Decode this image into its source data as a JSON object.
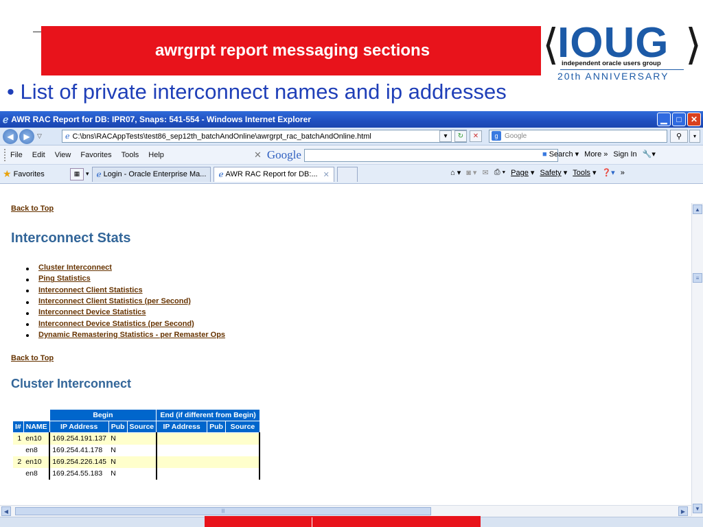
{
  "slide": {
    "banner_title": "awrgrpt report messaging sections",
    "logo": {
      "word": "IOUG",
      "subtitle": "independent oracle users group",
      "anniversary": "20th ANNIVERSARY"
    },
    "bullet": "List of private interconnect names and ip addresses"
  },
  "browser": {
    "window_title": "AWR RAC Report for DB: IPR07, Snaps: 541-554 - Windows Internet Explorer",
    "address": "C:\\bns\\RACAppTests\\test86_sep12th_batchAndOnline\\awrgrpt_rac_batchAndOnline.html",
    "search_placeholder": "Google",
    "menu": [
      "File",
      "Edit",
      "View",
      "Favorites",
      "Tools",
      "Help"
    ],
    "google_toolbar": {
      "logo": "Google",
      "search": "Search",
      "more": "More »",
      "signin": "Sign In"
    },
    "favorites_label": "Favorites",
    "tabs": [
      {
        "label": "Login - Oracle Enterprise Ma..."
      },
      {
        "label": "AWR RAC Report for DB:..."
      }
    ],
    "commands": {
      "page": "Page",
      "safety": "Safety",
      "tools": "Tools"
    }
  },
  "page": {
    "back_to_top": "Back to Top",
    "heading": "Interconnect Stats",
    "links": [
      "Cluster Interconnect",
      "Ping Statistics",
      "Interconnect Client Statistics",
      "Interconnect Client Statistics (per Second)",
      "Interconnect Device Statistics",
      "Interconnect Device Statistics (per Second)",
      "Dynamic Remastering Statistics - per Remaster Ops"
    ],
    "section_heading": "Cluster Interconnect",
    "table": {
      "group_begin": "Begin",
      "group_end": "End (if different from Begin)",
      "columns": [
        "I#",
        "NAME",
        "IP Address",
        "Pub",
        "Source",
        "IP Address",
        "Pub",
        "Source"
      ],
      "rows": [
        [
          "1",
          "en10",
          "169.254.191.137",
          "N",
          "",
          "",
          "",
          ""
        ],
        [
          "",
          "en8",
          "169.254.41.178",
          "N",
          "",
          "",
          "",
          ""
        ],
        [
          "2",
          "en10",
          "169.254.226.145",
          "N",
          "",
          "",
          "",
          ""
        ],
        [
          "",
          "en8",
          "169.254.55.183",
          "N",
          "",
          "",
          "",
          ""
        ]
      ]
    }
  }
}
